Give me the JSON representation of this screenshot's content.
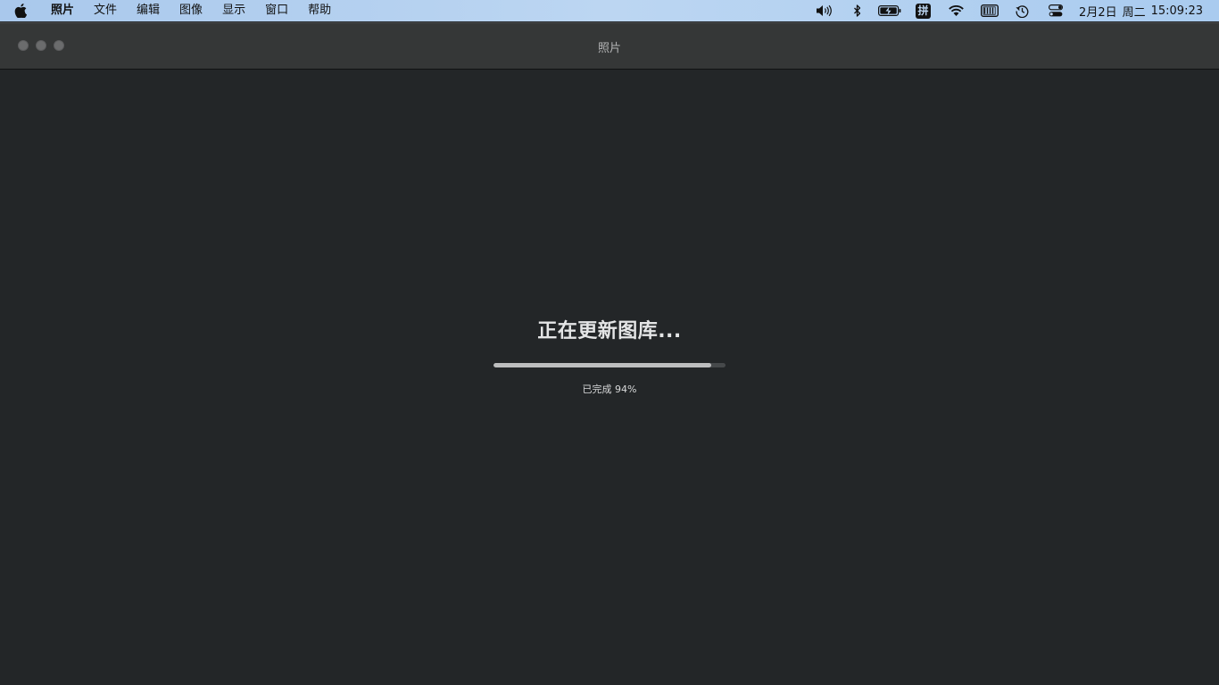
{
  "menubar": {
    "app_name": "照片",
    "items": [
      "文件",
      "编辑",
      "图像",
      "显示",
      "窗口",
      "帮助"
    ],
    "status_icons": [
      "volume-icon",
      "bluetooth-icon",
      "battery-icon",
      "input-method-icon",
      "wifi-icon",
      "keyboard-icon",
      "time-machine-icon",
      "control-center-icon"
    ],
    "input_method_label": "拼",
    "date": "2月2日",
    "weekday": "周二",
    "time": "15:09:23"
  },
  "window": {
    "title": "照片"
  },
  "progress": {
    "heading": "正在更新图库...",
    "status_text": "已完成 94%",
    "fraction": 0.94
  }
}
